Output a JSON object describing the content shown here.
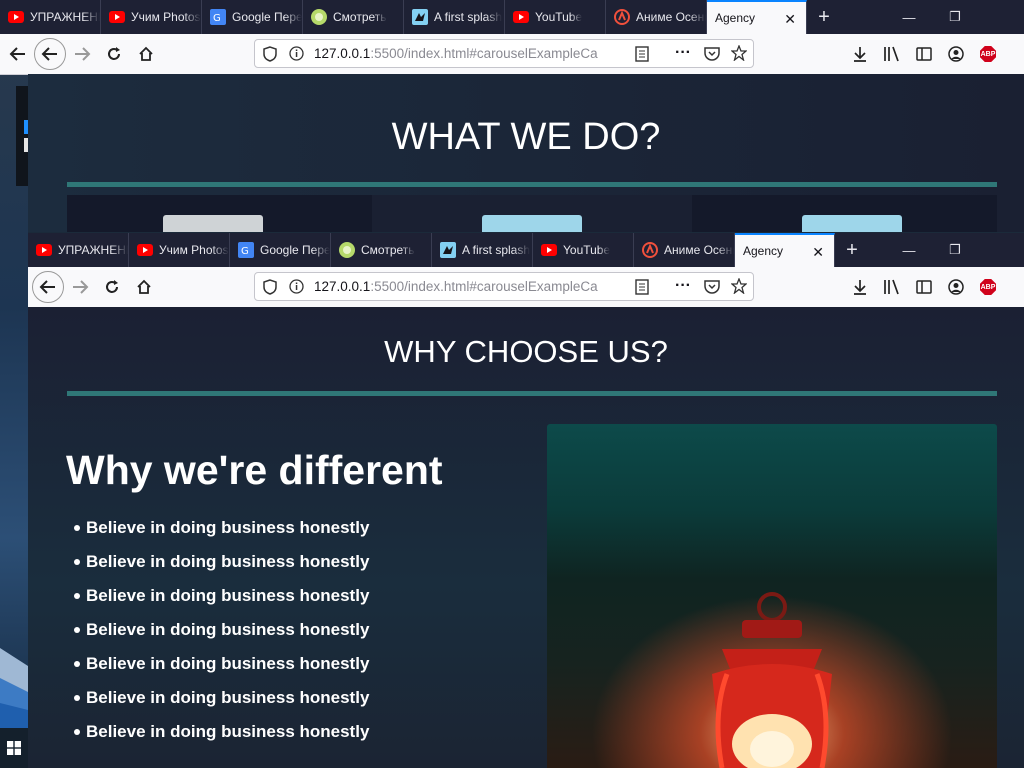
{
  "tabs": [
    {
      "label": "УПРАЖНЕНИЕ",
      "icon": "youtube-icon"
    },
    {
      "label": "Учим Photoshop",
      "icon": "youtube-icon"
    },
    {
      "label": "Google Переводчик",
      "icon": "google-translate-icon"
    },
    {
      "label": "Смотреть",
      "icon": "green-site-icon"
    },
    {
      "label": "A first splash",
      "icon": "mdn-icon"
    },
    {
      "label": "YouTube",
      "icon": "youtube-icon"
    },
    {
      "label": "Аниме Осень",
      "icon": "anime-site-icon"
    }
  ],
  "active_tab": {
    "label": "Agency",
    "close": "✕"
  },
  "new_tab": "+",
  "url": {
    "host": "127.0.0.1",
    "rest": ":5500/index.html#carouselExampleCa"
  },
  "page1": {
    "heading": "WHAT WE DO?"
  },
  "page2": {
    "heading": "WHY CHOOSE US?",
    "subheading": "Why we're different",
    "reasons": [
      "Believe in doing business honestly",
      "Believe in doing business honestly",
      "Believe in doing business honestly",
      "Believe in doing business honestly",
      "Believe in doing business honestly",
      "Believe in doing business honestly",
      "Believe in doing business honestly"
    ]
  },
  "colors": {
    "accent": "#2f7777",
    "tab_active_border": "#0a84ff",
    "tabbar": "#1e2134"
  }
}
